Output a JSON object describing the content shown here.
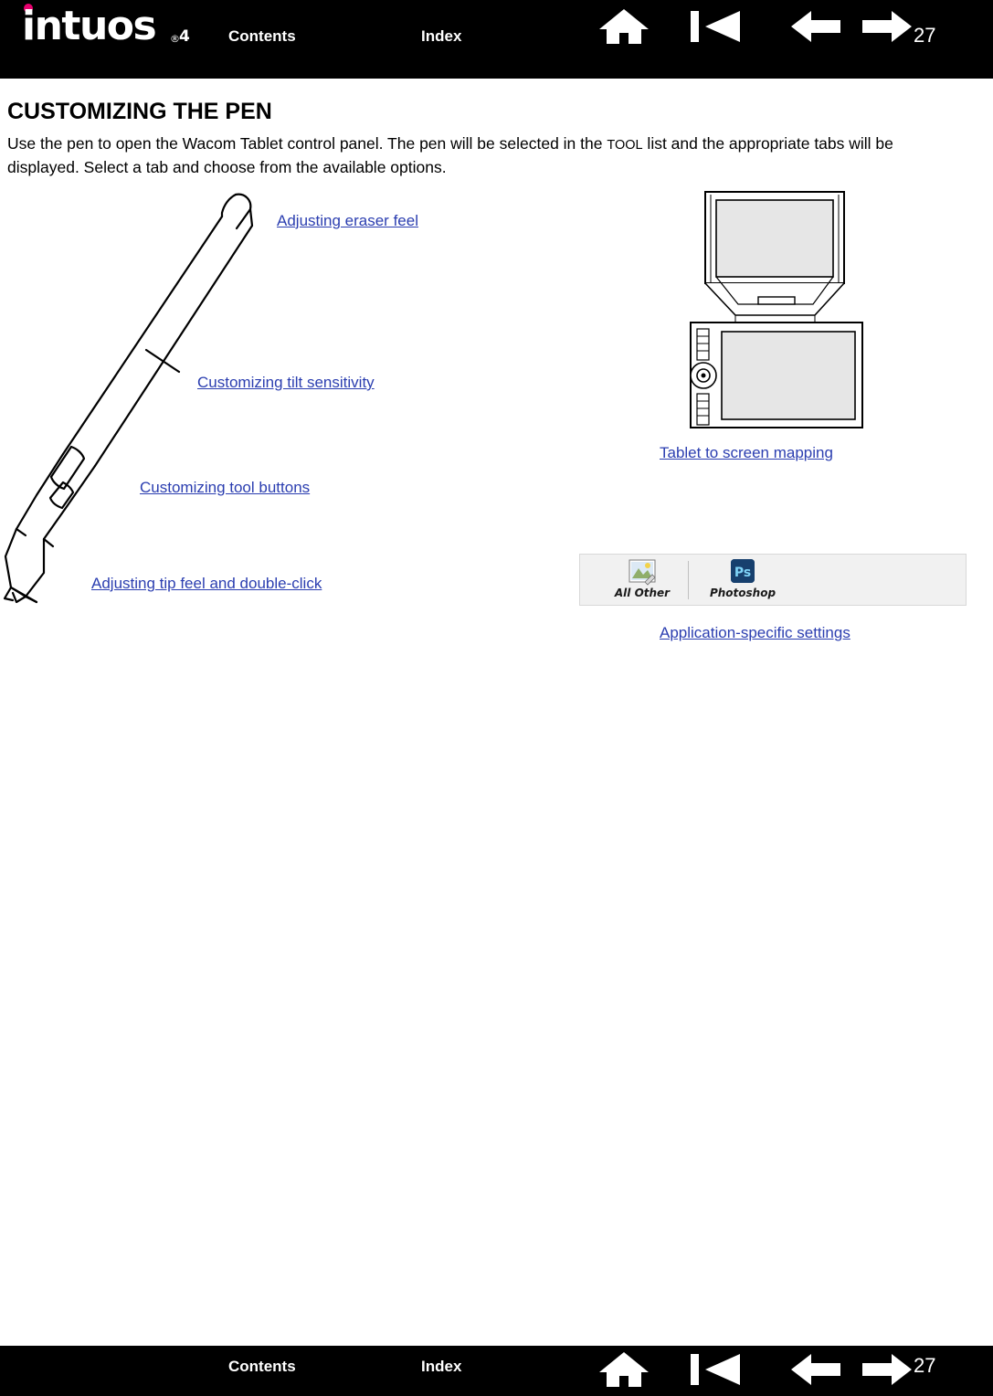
{
  "header": {
    "brand": "intuos",
    "brand_suffix": "4",
    "contents_label": "Contents",
    "index_label": "Index",
    "page_number": "27",
    "icons": [
      {
        "name": "home-icon",
        "label": "Home"
      },
      {
        "name": "first-page-icon",
        "label": "First page"
      },
      {
        "name": "previous-page-icon",
        "label": "Previous page"
      },
      {
        "name": "next-page-icon",
        "label": "Next page"
      }
    ]
  },
  "content": {
    "title": "CUSTOMIZING THE PEN",
    "intro_part1": "Use the pen to open the Wacom Tablet control panel.  The pen will be selected in the ",
    "intro_smallcap": "TOOL",
    "intro_part2": " list and the appropriate tabs will be displayed.  Select a tab and choose from the available options.",
    "links": [
      {
        "id": "eraser",
        "label": "Adjusting eraser feel"
      },
      {
        "id": "tilt",
        "label": "Customizing tilt sensitivity"
      },
      {
        "id": "tool-buttons",
        "label": "Customizing tool buttons"
      },
      {
        "id": "tip-feel",
        "label": "Adjusting tip feel and double-click"
      },
      {
        "id": "mapping",
        "label": "Tablet to screen mapping"
      },
      {
        "id": "app-specific",
        "label": "Application-specific settings"
      }
    ],
    "app_toolbar": {
      "items": [
        {
          "name": "all-other-tab",
          "label": "All Other",
          "icon": "all-other-icon"
        },
        {
          "name": "photoshop-tab",
          "label": "Photoshop",
          "icon": "photoshop-icon"
        }
      ]
    },
    "figures": [
      {
        "name": "pen-illustration",
        "label": "Intuos4 pen illustration"
      },
      {
        "name": "tablet-monitor-illustration",
        "label": "Tablet to screen mapping illustration"
      }
    ]
  },
  "footer": {
    "contents_label": "Contents",
    "index_label": "Index",
    "page_number": "27",
    "icons": [
      {
        "name": "home-icon",
        "label": "Home"
      },
      {
        "name": "first-page-icon",
        "label": "First page"
      },
      {
        "name": "previous-page-icon",
        "label": "Previous page"
      },
      {
        "name": "next-page-icon",
        "label": "Next page"
      }
    ]
  },
  "colors": {
    "bar": "#000000",
    "link": "#2b3eb0",
    "accent": "#e5006d",
    "text": "#000000"
  }
}
